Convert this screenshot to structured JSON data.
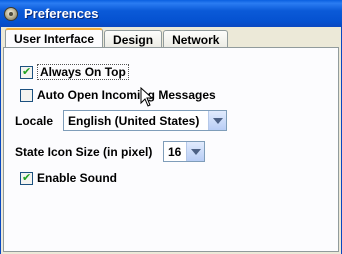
{
  "window": {
    "title": "Preferences"
  },
  "tabs": [
    {
      "label": "User Interface",
      "active": true
    },
    {
      "label": "Design",
      "active": false
    },
    {
      "label": "Network",
      "active": false
    }
  ],
  "settings": {
    "always_on_top": {
      "label": "Always On Top",
      "checked": true
    },
    "auto_open": {
      "label": "Auto Open Incoming Messages",
      "checked": false
    },
    "locale": {
      "label": "Locale",
      "value": "English (United States)"
    },
    "state_icon_size": {
      "label": "State Icon Size (in pixel)",
      "value": "16"
    },
    "enable_sound": {
      "label": "Enable Sound",
      "checked": true
    }
  },
  "glyphs": {
    "check": "✔"
  }
}
